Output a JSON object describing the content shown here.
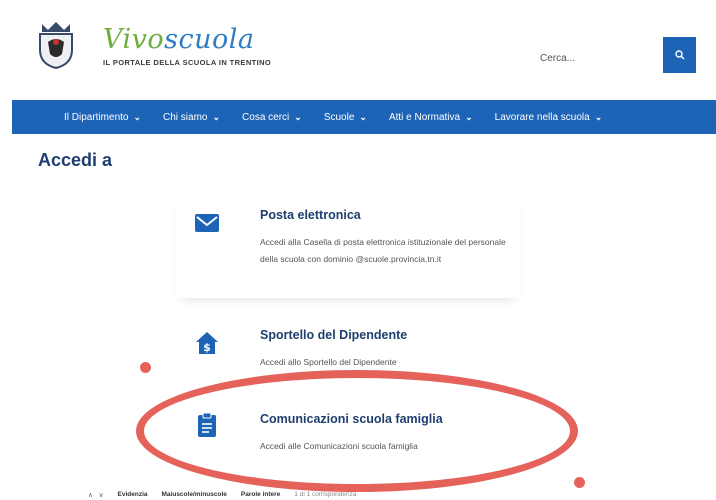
{
  "header": {
    "brand_part1": "Vivo",
    "brand_part2": "scuola",
    "brand_subtitle": "IL PORTALE DELLA SCUOLA IN TRENTINO",
    "search_placeholder": "Cerca...",
    "search_icon": "search-icon"
  },
  "nav": {
    "items": [
      {
        "label": "Il Dipartimento"
      },
      {
        "label": "Chi siamo"
      },
      {
        "label": "Cosa cerci"
      },
      {
        "label": "Scuole"
      },
      {
        "label": "Atti e Normativa"
      },
      {
        "label": "Lavorare nella scuola"
      }
    ]
  },
  "page": {
    "title": "Accedi a"
  },
  "cards": [
    {
      "title": "Posta elettronica",
      "desc": "Accedi alla Casella di posta elettronica istituzionale del personale della scuola con dominio @scuole.provincia.tn.it",
      "icon": "envelope-icon"
    },
    {
      "title": "Sportello del Dipendente",
      "desc": "Accedi allo Sportello del Dipendente",
      "icon": "house-dollar-icon"
    },
    {
      "title": "Comunicazioni scuola famiglia",
      "desc": "Accedi alle Comunicazioni scuola famiglia",
      "icon": "clipboard-icon"
    }
  ],
  "findbar": {
    "up": "∧",
    "down": "∨",
    "highlight": "Evidenzia",
    "match_case": "Maiuscole/minuscole",
    "whole_words": "Parole intere",
    "result": "1 di 1 corrispondenza"
  },
  "colors": {
    "brand_blue": "#1d63b6",
    "title_navy": "#1f3f70",
    "vivo_green": "#6cae3e",
    "annotation_red": "#e0463e"
  }
}
